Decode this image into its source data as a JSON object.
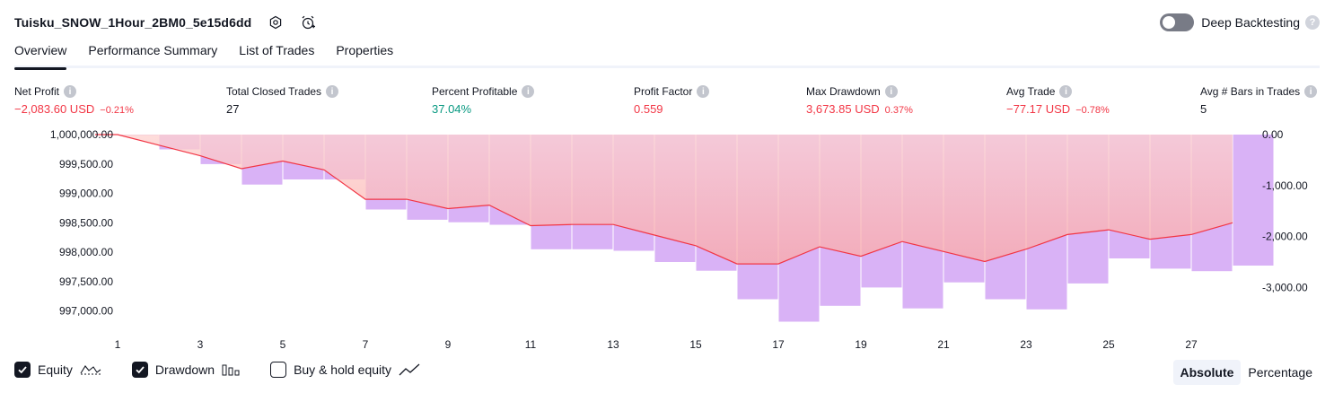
{
  "header": {
    "title": "Tuisku_SNOW_1Hour_2BM0_5e15d6dd",
    "icons": [
      "settings-icon",
      "alarm-add-icon"
    ],
    "deep_backtesting_label": "Deep Backtesting",
    "deep_backtesting_on": false,
    "help_glyph": "?"
  },
  "tabs": [
    {
      "label": "Overview",
      "active": true
    },
    {
      "label": "Performance Summary",
      "active": false
    },
    {
      "label": "List of Trades",
      "active": false
    },
    {
      "label": "Properties",
      "active": false
    }
  ],
  "metrics": [
    {
      "label": "Net Profit",
      "value": "−2,083.60 USD",
      "sub": "−0.21%",
      "tone": "neg"
    },
    {
      "label": "Total Closed Trades",
      "value": "27",
      "sub": "",
      "tone": "neu"
    },
    {
      "label": "Percent Profitable",
      "value": "37.04%",
      "sub": "",
      "tone": "pos"
    },
    {
      "label": "Profit Factor",
      "value": "0.559",
      "sub": "",
      "tone": "neg"
    },
    {
      "label": "Max Drawdown",
      "value": "3,673.85 USD",
      "sub": "0.37%",
      "tone": "neg"
    },
    {
      "label": "Avg Trade",
      "value": "−77.17 USD",
      "sub": "−0.78%",
      "tone": "neg"
    },
    {
      "label": "Avg # Bars in Trades",
      "value": "5",
      "sub": "",
      "tone": "neu"
    }
  ],
  "chart_data": {
    "type": "bar+line",
    "x_ticks": [
      "1",
      "3",
      "5",
      "7",
      "9",
      "11",
      "13",
      "15",
      "17",
      "19",
      "21",
      "23",
      "25",
      "27"
    ],
    "left_axis": {
      "ticks": [
        "1,000,000.00",
        "999,500.00",
        "999,000.00",
        "998,500.00",
        "998,000.00",
        "997,500.00",
        "997,000.00"
      ],
      "ylim": [
        996800,
        1000000
      ]
    },
    "right_axis": {
      "ticks": [
        "0.00",
        "-1,000.00",
        "-2,000.00",
        "-3,000.00"
      ],
      "ylim": [
        -3680,
        0
      ]
    },
    "series": [
      {
        "name": "Equity",
        "type": "line",
        "color": "#f23645",
        "x": [
          0,
          1,
          2,
          3,
          4,
          5,
          6,
          7,
          8,
          9,
          10,
          11,
          12,
          13,
          14,
          15,
          16,
          17,
          18,
          19,
          20,
          21,
          22,
          23,
          24,
          25,
          26,
          27,
          28
        ],
        "values": [
          1000000,
          1000000,
          999820,
          999640,
          999420,
          999550,
          999400,
          998900,
          998900,
          998740,
          998800,
          998450,
          998470,
          998470,
          998290,
          998110,
          997800,
          997800,
          998090,
          997930,
          998180,
          998010,
          997840,
          998050,
          998300,
          998380,
          998220,
          998300,
          998500
        ]
      },
      {
        "name": "Drawdown",
        "type": "bar",
        "color": "#d9b2f6",
        "x": [
          1,
          2,
          3,
          4,
          5,
          6,
          7,
          8,
          9,
          10,
          11,
          12,
          13,
          14,
          15,
          16,
          17,
          18,
          19,
          20,
          21,
          22,
          23,
          24,
          25,
          26,
          27,
          28
        ],
        "values": [
          -10,
          -290,
          -580,
          -980,
          -880,
          -880,
          -1470,
          -1670,
          -1720,
          -1770,
          -2250,
          -2250,
          -2280,
          -2500,
          -2670,
          -3230,
          -3670,
          -3360,
          -3000,
          -3410,
          -2900,
          -3230,
          -3430,
          -2920,
          -2430,
          -2630,
          -2680,
          -2570
        ]
      }
    ],
    "legend": [
      {
        "label": "Equity",
        "checked": true,
        "glyph": "equity-line-icon"
      },
      {
        "label": "Drawdown",
        "checked": true,
        "glyph": "drawdown-bars-icon"
      },
      {
        "label": "Buy & hold equity",
        "checked": false,
        "glyph": "trend-line-icon"
      }
    ],
    "modes": [
      {
        "label": "Absolute",
        "active": true
      },
      {
        "label": "Percentage",
        "active": false
      }
    ]
  }
}
